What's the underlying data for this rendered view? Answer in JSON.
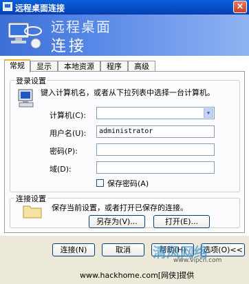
{
  "window": {
    "title": "远程桌面连接",
    "close_glyph": "×"
  },
  "banner": {
    "line1": "远程桌面",
    "line2": "连接"
  },
  "tabs": [
    {
      "label": "常规",
      "active": true
    },
    {
      "label": "显示",
      "active": false
    },
    {
      "label": "本地资源",
      "active": false
    },
    {
      "label": "程序",
      "active": false
    },
    {
      "label": "高级",
      "active": false
    }
  ],
  "login": {
    "legend": "登录设置",
    "instruction": "键入计算机名，或者从下拉列表中选择一台计算机。",
    "computer_label": "计算机(C):",
    "computer_value": "",
    "username_label": "用户名(U):",
    "username_value": "administrator",
    "password_label": "密码(P):",
    "password_value": "",
    "domain_label": "域(D):",
    "domain_value": "",
    "save_password_label": "保存密码(A)",
    "save_password_checked": false
  },
  "connection": {
    "legend": "连接设置",
    "description": "保存当前设置，或者打开已保存的连接。",
    "save_as_label": "另存为(V)...",
    "open_label": "打开(E)..."
  },
  "buttons": {
    "connect": "连接(N)",
    "cancel": "取消",
    "help": "帮助(H)",
    "options": "选项(O)<<"
  },
  "watermark": {
    "brand": "清风网络",
    "url": "www.vipcn.com"
  },
  "site_caption": "www.hackhome.com[网侠]提供",
  "colors": {
    "titlebar": "#0a5fd8",
    "tab_highlight": "#f5b42a",
    "panel_bg": "#fcfcfe"
  }
}
